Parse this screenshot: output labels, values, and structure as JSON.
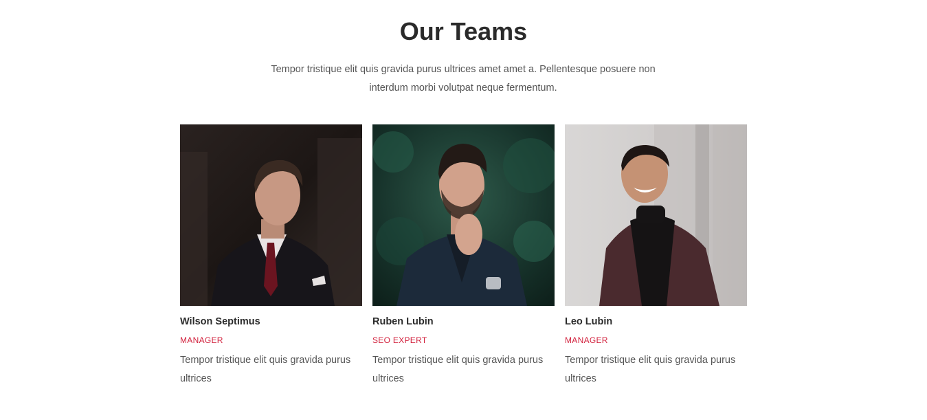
{
  "section": {
    "title": "Our Teams",
    "subtitle": "Tempor tristique elit quis gravida purus ultrices amet amet a. Pellentesque posuere non interdum morbi volutpat neque fermentum."
  },
  "team": [
    {
      "name": "Wilson Septimus",
      "role": "MANAGER",
      "description": "Tempor tristique elit quis gravida purus ultrices"
    },
    {
      "name": "Ruben Lubin",
      "role": "SEO EXPERT",
      "description": "Tempor tristique elit quis gravida purus ultrices"
    },
    {
      "name": "Leo Lubin",
      "role": "MANAGER",
      "description": "Tempor tristique elit quis gravida purus ultrices"
    }
  ],
  "colors": {
    "accent": "#d2213d",
    "heading": "#2a2a2a",
    "body": "#555555"
  }
}
